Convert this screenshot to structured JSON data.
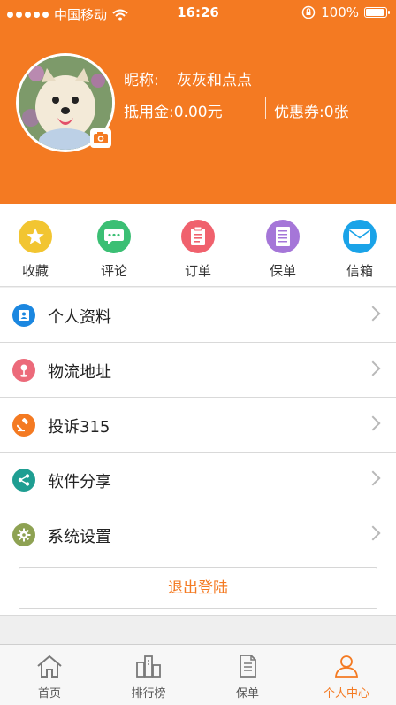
{
  "status_bar": {
    "carrier": "中国移动",
    "time": "16:26",
    "battery": "100%",
    "battery_level": 1.0
  },
  "profile": {
    "nickname_label": "昵称:",
    "nickname": "灰灰和点点",
    "credit": "抵用金:0.00元",
    "coupon": "优惠券:0张"
  },
  "quick_actions": [
    {
      "label": "收藏",
      "icon": "star-icon",
      "color": "#f2c531"
    },
    {
      "label": "评论",
      "icon": "comment-icon",
      "color": "#3bbf74"
    },
    {
      "label": "订单",
      "icon": "order-icon",
      "color": "#f0616d"
    },
    {
      "label": "保单",
      "icon": "policy-icon",
      "color": "#a576d8"
    },
    {
      "label": "信箱",
      "icon": "mail-icon",
      "color": "#1aa3e8"
    }
  ],
  "menu": [
    {
      "label": "个人资料",
      "icon": "profile-card-icon",
      "color": "#1b87e0"
    },
    {
      "label": "物流地址",
      "icon": "location-pin-icon",
      "color": "#ec6a7a"
    },
    {
      "label": "投诉315",
      "icon": "gavel-icon",
      "color": "#f47a22"
    },
    {
      "label": "软件分享",
      "icon": "share-icon",
      "color": "#1f9e92"
    },
    {
      "label": "系统设置",
      "icon": "gear-icon",
      "color": "#8ea253"
    }
  ],
  "logout_label": "退出登陆",
  "tabbar": {
    "items": [
      {
        "label": "首页",
        "icon": "home-icon"
      },
      {
        "label": "排行榜",
        "icon": "ranking-icon"
      },
      {
        "label": "保单",
        "icon": "document-icon"
      },
      {
        "label": "个人中心",
        "icon": "person-icon"
      }
    ],
    "active_color": "#f47a22"
  }
}
